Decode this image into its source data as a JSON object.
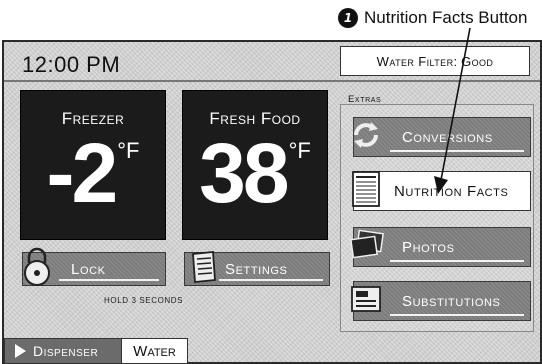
{
  "callout": {
    "number": "1",
    "text": "Nutrition Facts Button"
  },
  "header": {
    "time": "12:00 PM",
    "water_filter_label": "Water Filter:",
    "water_filter_status": "Good"
  },
  "freezer": {
    "label": "Freezer",
    "value": "-2",
    "unit": "°F"
  },
  "fresh_food": {
    "label": "Fresh Food",
    "value": "38",
    "unit": "°F"
  },
  "buttons": {
    "lock": "Lock",
    "lock_note": "HOLD 3 SECONDS",
    "settings": "Settings"
  },
  "extras": {
    "label": "Extras",
    "items": [
      "Conversions",
      "Nutrition Facts",
      "Photos",
      "Substitutions"
    ]
  },
  "dispenser": {
    "label": "Dispenser",
    "mode": "Water"
  }
}
